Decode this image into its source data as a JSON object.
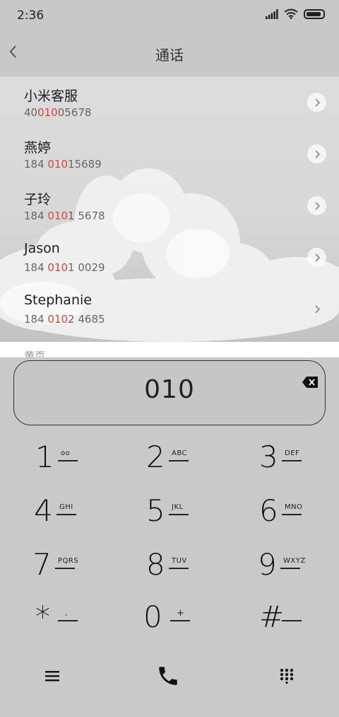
{
  "status": {
    "time": "2:36"
  },
  "header": {
    "title": "通话"
  },
  "results": [
    {
      "name": "小米客服",
      "number_parts": [
        "40",
        "010",
        "05678"
      ]
    },
    {
      "name": "燕婷",
      "number_parts": [
        "184 ",
        "010",
        "15689"
      ]
    },
    {
      "name": "子玲",
      "number_parts": [
        "184 ",
        "010",
        "1 5678"
      ]
    },
    {
      "name": "Jason",
      "number_parts": [
        "184 ",
        "010",
        "1 0029"
      ]
    },
    {
      "name": "Stephanie",
      "number_parts": [
        "184 ",
        "010",
        "2 4685"
      ]
    }
  ],
  "section": {
    "label": "黄页"
  },
  "dialer": {
    "input_value": "010",
    "keys": [
      {
        "digit": "1",
        "letters": "oo"
      },
      {
        "digit": "2",
        "letters": "ABC"
      },
      {
        "digit": "3",
        "letters": "DEF"
      },
      {
        "digit": "4",
        "letters": "GHI"
      },
      {
        "digit": "5",
        "letters": "JKL"
      },
      {
        "digit": "6",
        "letters": "MNO"
      },
      {
        "digit": "7",
        "letters": "PQRS"
      },
      {
        "digit": "8",
        "letters": "TUV"
      },
      {
        "digit": "9",
        "letters": "WXYZ"
      },
      {
        "digit": "*",
        "letters": ","
      },
      {
        "digit": "0",
        "letters": "+"
      },
      {
        "digit": "#",
        "letters": ""
      }
    ]
  },
  "icons": {
    "back": "back-arrow-icon",
    "signal": "signal-icon",
    "wifi": "wifi-icon",
    "battery": "battery-icon",
    "chevron": "chevron-right-icon",
    "backspace": "backspace-icon",
    "menu": "menu-icon",
    "phone": "phone-icon",
    "keypad": "keypad-icon"
  },
  "colors": {
    "highlight": "#d9453b",
    "background": "#c9c9c9"
  }
}
